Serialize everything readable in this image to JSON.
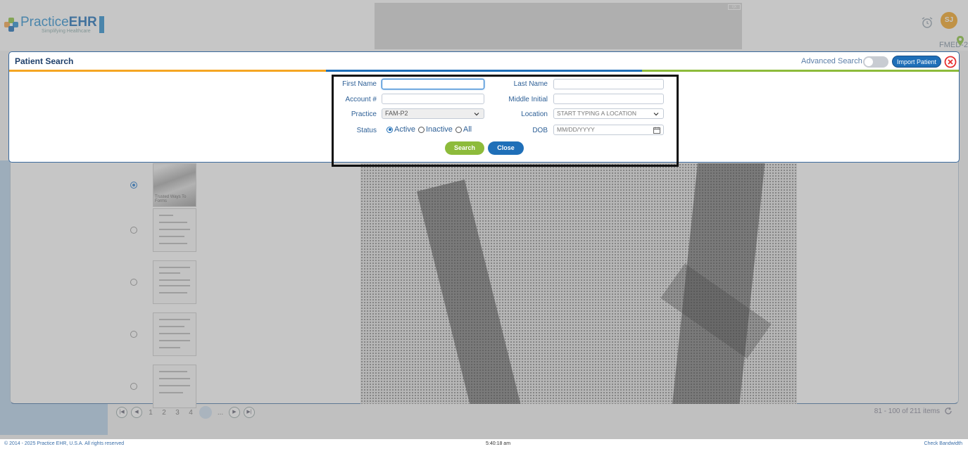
{
  "brand": {
    "name_part1": "Practice",
    "name_part2": "EHR",
    "tagline": "Simplifying Healthcare",
    "logo_colors": [
      "#f7a64b",
      "#8cc63f",
      "#2a8fd1",
      "#1d6fb8"
    ]
  },
  "header": {
    "user_initials": "SJ",
    "facility": "FMED-2",
    "ad_choice": "i|x"
  },
  "document_list": {
    "thumbnails": [
      {
        "caption": "Trusted Ways To Forms",
        "selected": true
      },
      {
        "caption": "",
        "selected": false
      },
      {
        "caption": "",
        "selected": false
      },
      {
        "caption": "",
        "selected": false
      },
      {
        "caption": "",
        "selected": false
      }
    ]
  },
  "pager": {
    "first": "|◀",
    "prev": "◀",
    "next": "▶",
    "last": "▶|",
    "pages": [
      "1",
      "2",
      "3",
      "4",
      "...",
      "..."
    ],
    "info": "81 - 100 of 211 items"
  },
  "footer": {
    "copyright": "© 2014 - 2025 Practice EHR, U.S.A. All rights reserved",
    "clock": "5:40:18 am",
    "bandwidth": "Check Bandwidth"
  },
  "modal": {
    "title": "Patient Search",
    "advanced_search_label": "Advanced Search",
    "advanced_search_on": false,
    "import_label": "Import Patient",
    "stripe_colors": [
      "#f5a623",
      "#1f6fb8",
      "#8dbb3b"
    ],
    "form": {
      "first_name_label": "First Name",
      "first_name_value": "",
      "last_name_label": "Last Name",
      "last_name_value": "",
      "account_label": "Account #",
      "account_value": "",
      "middle_initial_label": "Middle Initial",
      "middle_initial_value": "",
      "practice_label": "Practice",
      "practice_value": "FAM-P2",
      "location_label": "Location",
      "location_placeholder": "START TYPING A LOCATION",
      "status_label": "Status",
      "status_options": [
        "Active",
        "Inactive",
        "All"
      ],
      "status_selected": "Active",
      "dob_label": "DOB",
      "dob_placeholder": "MM/DD/YYYY",
      "search_button": "Search",
      "close_button": "Close"
    }
  }
}
